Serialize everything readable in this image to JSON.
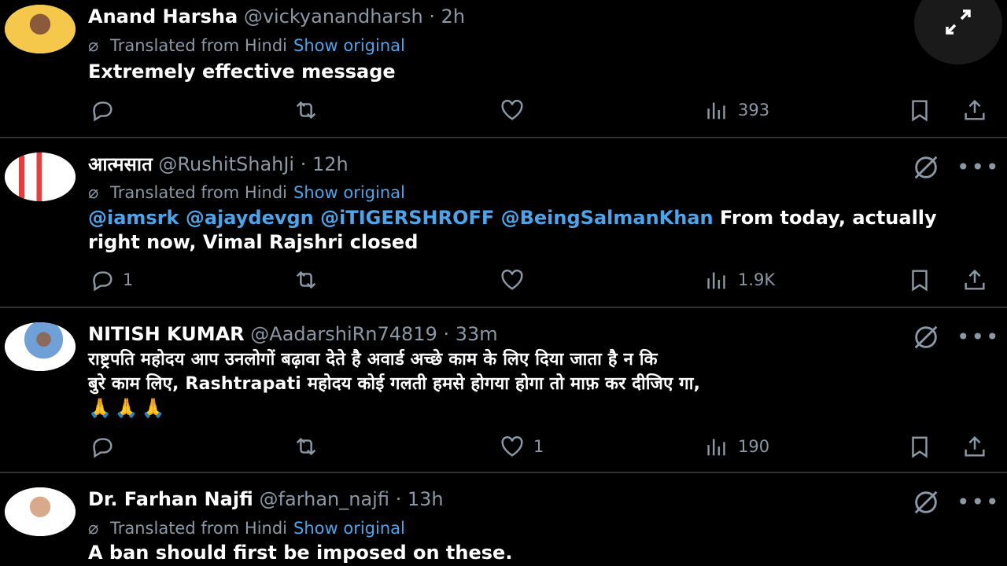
{
  "tweets": [
    {
      "name": "Anand Harsha",
      "handle": "@vickyanandharsh",
      "time": "· 2h",
      "translated": "Translated from Hindi",
      "show_original": "Show original",
      "text": "Extremely effective message",
      "replies": "",
      "likes": "",
      "views": "393",
      "avatar_color": "#f5c84c"
    },
    {
      "name": "आत्मसात",
      "handle": "@RushitShahJi",
      "time": "· 12h",
      "translated": "Translated from Hindi",
      "show_original": "Show original",
      "mentions": "@iamsrk @ajaydevgn @iTIGERSHROFF @BeingSalmanKhan",
      "text": "From today, actually right now, Vimal Rajshri closed",
      "replies": "1",
      "likes": "",
      "views": "1.9K",
      "avatar_color": "#e04040"
    },
    {
      "name": "NITISH KUMAR",
      "handle": "@AadarshiRn74819",
      "time": "· 33m",
      "text_line1": "राष्ट्रपति महोदय आप उनलोगों बढ़ावा देते है  अवार्ड अच्छे काम के लिए दिया जाता है न  कि",
      "text_line2": "बुरे  काम लिए, Rashtrapati महोदय कोई गलती हमसे होगया होगा तो माफ़ कर दीजिए गा,",
      "emoji": "🙏🙏🙏",
      "replies": "",
      "likes": "1",
      "views": "190",
      "avatar_color": "#6fa0d8"
    },
    {
      "name": "Dr. Farhan Najfi",
      "handle": "@farhan_najfi",
      "time": "· 13h",
      "translated": "Translated from Hindi",
      "show_original": "Show original",
      "text": "A ban should first be imposed on these.",
      "avatar_color": "#d9a98c"
    }
  ],
  "icons": {
    "reply": "reply-icon",
    "retweet": "retweet-icon",
    "like": "heart-icon",
    "views": "views-icon",
    "bookmark": "bookmark-icon",
    "share": "share-icon",
    "grok": "grok-icon",
    "more": "more-icon",
    "expand": "expand-icon",
    "translate": "translate-icon"
  },
  "colors": {
    "background": "#000000",
    "link": "#4fa3e8",
    "muted": "#8b98a5",
    "divider": "#2f3336"
  }
}
